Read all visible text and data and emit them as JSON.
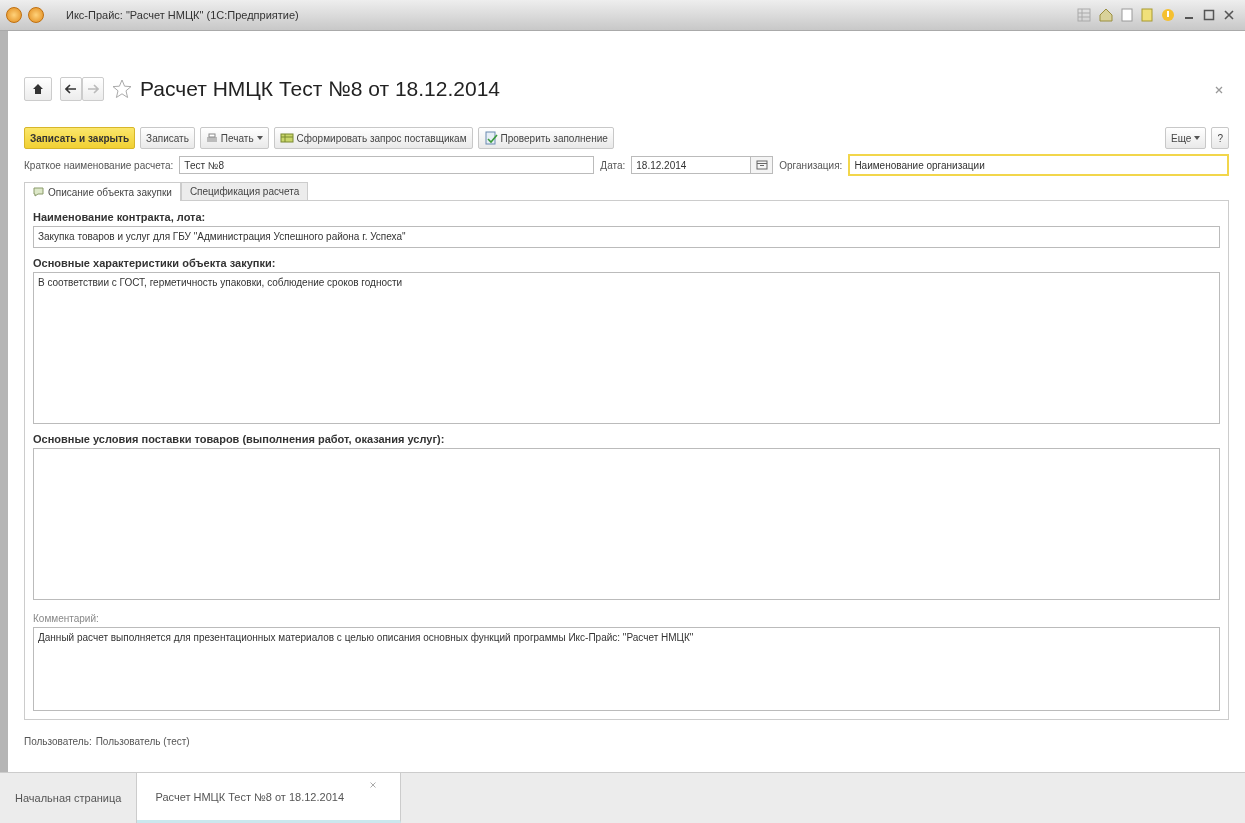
{
  "window": {
    "title": "Икс-Прайс: \"Расчет НМЦК\" (1С:Предприятие)"
  },
  "document": {
    "title": "Расчет НМЦК Тест №8 от 18.12.2014",
    "favorite": false
  },
  "toolbar": [
    {
      "kind": "primary",
      "label": "Записать и закрыть"
    },
    {
      "kind": "plain",
      "label": "Записать"
    },
    {
      "kind": "print",
      "label": "Печать"
    },
    {
      "kind": "table",
      "label": "Сформировать запрос поставщикам"
    },
    {
      "kind": "check",
      "label": "Проверить заполнение"
    }
  ],
  "more_button": {
    "label": "Еще"
  },
  "help_button": {
    "label": "?"
  },
  "header_fields": [
    {
      "kind": "text",
      "label": "Краткое наименование расчета:",
      "value": "Тест №8",
      "focused": false
    },
    {
      "kind": "date",
      "label": "Дата:",
      "value": "18.12.2014",
      "focused": false
    },
    {
      "kind": "text",
      "label": "Организация:",
      "value": "Наименование организации",
      "focused": true
    }
  ],
  "tabs": [
    {
      "label": "Описание объекта закупки",
      "selected": true
    },
    {
      "label": "Спецификация расчета",
      "selected": false
    }
  ],
  "fields": [
    {
      "kind": "line",
      "label": "Наименование контракта, лота:",
      "value": "Закупка товаров и услуг для ГБУ \"Администрация Успешного района г. Успеха\""
    },
    {
      "kind": "area",
      "label": "Основные характеристики объекта закупки:",
      "value": "В соответствии с ГОСТ, герметичность упаковки, соблюдение сроков годности"
    },
    {
      "kind": "area",
      "label": "Основные условия поставки товаров (выполнения работ, оказания услуг):"
    },
    {
      "kind": "note",
      "label": "Комментарий:",
      "value": "Данный расчет выполняется для презентационных материалов с целью описания основных функций программы Икс-Прайс: \"Расчет НМЦК\""
    }
  ],
  "user_line": {
    "label": "Пользователь:",
    "value": "Пользователь (тест)"
  },
  "open_windows": [
    {
      "label": "Начальная страница",
      "selected": false
    },
    {
      "label": "Расчет НМЦК Тест №8 от 18.12.2014",
      "selected": true
    }
  ]
}
